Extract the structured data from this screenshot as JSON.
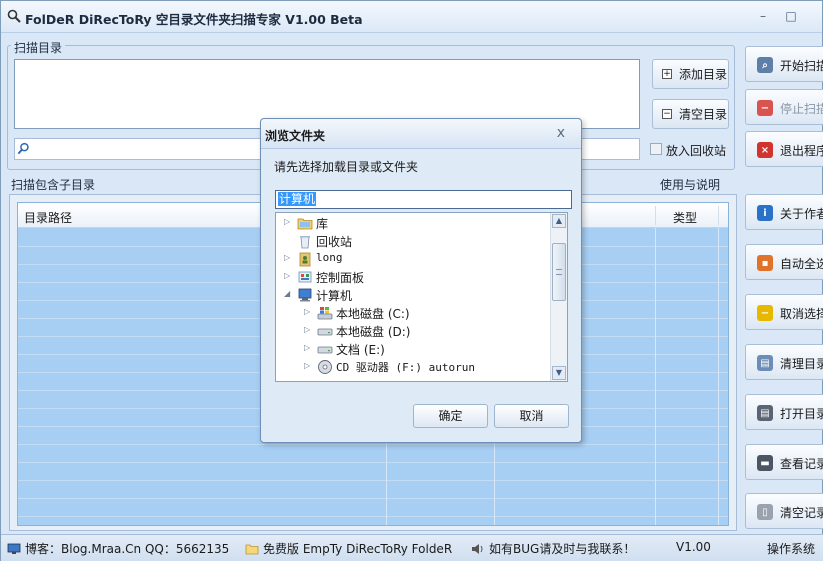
{
  "window": {
    "title": "FolDeR DiRecToRy 空目录文件夹扫描专家 V1.00 Beta",
    "minimize": "–",
    "maximize": "□"
  },
  "scan_dir": {
    "group_label": "扫描目录",
    "add_button": "添加目录",
    "clear_button": "清空目录",
    "recycle_checkbox": "放入回收站",
    "recycle_checked": false
  },
  "scan_sub_label": "扫描包含子目录",
  "usage_label": "使用与说明",
  "table": {
    "columns": [
      "目录路径",
      "类型"
    ]
  },
  "right_buttons": [
    {
      "label": "开始扫描",
      "icon": "search-folder-icon",
      "color": "#5d7fa8",
      "enabled": true
    },
    {
      "label": "停止扫描",
      "icon": "stop-icon",
      "color": "#d9534f",
      "enabled": false
    },
    {
      "label": "退出程序",
      "icon": "exit-icon",
      "color": "#d0342c",
      "enabled": true
    },
    {
      "label": "关于作者",
      "icon": "info-icon",
      "color": "#2a72c8",
      "enabled": true
    },
    {
      "label": "自动全选",
      "icon": "select-all-icon",
      "color": "#e0722a",
      "enabled": true
    },
    {
      "label": "取消选择",
      "icon": "deselect-icon",
      "color": "#e6b800",
      "enabled": true
    },
    {
      "label": "清理目录",
      "icon": "trash-icon",
      "color": "#6c8db5",
      "enabled": true
    },
    {
      "label": "打开目录",
      "icon": "open-folder-icon",
      "color": "#5a6472",
      "enabled": true
    },
    {
      "label": "查看记录",
      "icon": "printer-icon",
      "color": "#4b5563",
      "enabled": true
    },
    {
      "label": "清空记录",
      "icon": "document-icon",
      "color": "#9aa3ad",
      "enabled": true
    }
  ],
  "status_bar": {
    "blog": "博客：Blog.Mraa.Cn QQ：5662135",
    "edition": "免费版 EmpTy DiRecToRy FoldeR",
    "bug": "如有BUG请及时与我联系！",
    "version": "V1.00",
    "os": "操作系统"
  },
  "dialog": {
    "title": "浏览文件夹",
    "close": "x",
    "prompt": "请先选择加载目录或文件夹",
    "selected": "计算机",
    "tree": [
      {
        "label": "库",
        "icon": "library-icon",
        "level": 0,
        "arrow": "▷"
      },
      {
        "label": "回收站",
        "icon": "recycle-bin-icon",
        "level": 0,
        "arrow": ""
      },
      {
        "label": "long",
        "icon": "user-folder-icon",
        "level": 0,
        "arrow": "▷"
      },
      {
        "label": "控制面板",
        "icon": "control-panel-icon",
        "level": 0,
        "arrow": "▷"
      },
      {
        "label": "计算机",
        "icon": "computer-icon",
        "level": 0,
        "arrow": "◢"
      },
      {
        "label": "本地磁盘 (C:)",
        "icon": "system-drive-icon",
        "level": 1,
        "arrow": "▷"
      },
      {
        "label": "本地磁盘 (D:)",
        "icon": "drive-icon",
        "level": 1,
        "arrow": "▷"
      },
      {
        "label": "文档 (E:)",
        "icon": "drive-icon",
        "level": 1,
        "arrow": "▷"
      },
      {
        "label": "CD 驱动器 (F:) autorun",
        "icon": "cd-drive-icon",
        "level": 1,
        "arrow": "▷"
      }
    ],
    "ok_button": "确定",
    "cancel_button": "取消"
  }
}
